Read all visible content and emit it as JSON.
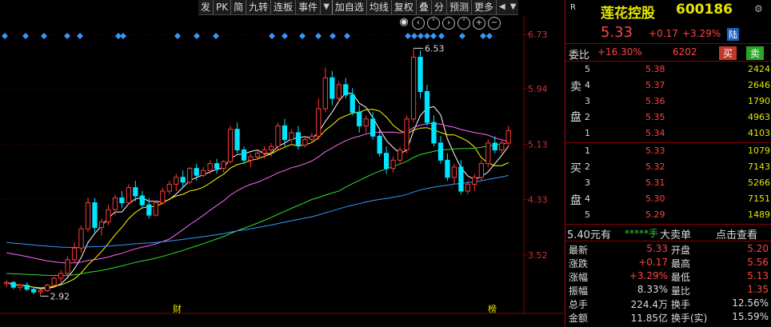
{
  "toolbar": {
    "items": [
      "发",
      "PK",
      "简",
      "九转",
      "连板",
      "事件",
      "加自选",
      "均线",
      "复权",
      "叠",
      "分",
      "预测",
      "更多"
    ]
  },
  "chart_data": {
    "type": "candlestick",
    "y_axis_labels": [
      "6.73",
      "5.94",
      "5.13",
      "4.33",
      "3.52"
    ],
    "ylim": [
      2.75,
      7.0
    ],
    "annotations": {
      "high_label": "6.53",
      "low_label": "2.92"
    },
    "bottom_markers": [
      "财",
      "榜"
    ],
    "candles": [
      [
        3.1,
        3.15,
        3.05,
        3.12
      ],
      [
        3.12,
        3.14,
        3.02,
        3.05
      ],
      [
        3.05,
        3.1,
        3.0,
        3.08
      ],
      [
        3.08,
        3.12,
        3.0,
        3.02
      ],
      [
        3.02,
        3.05,
        2.95,
        2.98
      ],
      [
        2.98,
        3.02,
        2.92,
        3.0
      ],
      [
        3.0,
        3.1,
        2.98,
        3.08
      ],
      [
        3.08,
        3.2,
        3.05,
        3.18
      ],
      [
        3.18,
        3.3,
        3.12,
        3.25
      ],
      [
        3.25,
        3.5,
        3.2,
        3.45
      ],
      [
        3.45,
        3.7,
        3.4,
        3.62
      ],
      [
        3.62,
        3.95,
        3.55,
        3.9
      ],
      [
        3.9,
        4.35,
        3.85,
        4.28
      ],
      [
        4.28,
        4.35,
        3.85,
        3.92
      ],
      [
        3.92,
        4.05,
        3.8,
        4.0
      ],
      [
        4.0,
        4.25,
        3.95,
        4.18
      ],
      [
        4.18,
        4.4,
        4.1,
        4.35
      ],
      [
        4.35,
        4.45,
        4.2,
        4.28
      ],
      [
        4.28,
        4.55,
        4.25,
        4.5
      ],
      [
        4.5,
        4.6,
        4.3,
        4.38
      ],
      [
        4.38,
        4.45,
        4.2,
        4.25
      ],
      [
        4.25,
        4.35,
        4.05,
        4.1
      ],
      [
        4.1,
        4.3,
        4.08,
        4.28
      ],
      [
        4.28,
        4.5,
        4.25,
        4.45
      ],
      [
        4.45,
        4.6,
        4.4,
        4.55
      ],
      [
        4.55,
        4.7,
        4.45,
        4.65
      ],
      [
        4.65,
        4.75,
        4.5,
        4.58
      ],
      [
        4.58,
        4.8,
        4.55,
        4.78
      ],
      [
        4.78,
        4.85,
        4.6,
        4.68
      ],
      [
        4.68,
        4.8,
        4.65,
        4.75
      ],
      [
        4.75,
        4.9,
        4.7,
        4.85
      ],
      [
        4.85,
        4.92,
        4.7,
        4.78
      ],
      [
        4.78,
        4.9,
        4.72,
        4.88
      ],
      [
        4.88,
        5.4,
        4.85,
        5.35
      ],
      [
        5.35,
        5.45,
        5.0,
        5.05
      ],
      [
        5.05,
        5.1,
        4.85,
        4.9
      ],
      [
        4.9,
        5.0,
        4.8,
        4.95
      ],
      [
        4.95,
        5.05,
        4.9,
        5.0
      ],
      [
        5.0,
        5.1,
        4.92,
        5.05
      ],
      [
        5.05,
        5.15,
        4.95,
        5.1
      ],
      [
        5.1,
        5.45,
        5.05,
        5.4
      ],
      [
        5.4,
        5.5,
        5.1,
        5.2
      ],
      [
        5.2,
        5.35,
        5.15,
        5.3
      ],
      [
        5.3,
        5.4,
        5.05,
        5.12
      ],
      [
        5.12,
        5.25,
        5.08,
        5.2
      ],
      [
        5.2,
        5.3,
        5.15,
        5.25
      ],
      [
        5.25,
        5.8,
        5.2,
        5.65
      ],
      [
        5.65,
        6.25,
        5.6,
        6.1
      ],
      [
        6.1,
        6.2,
        5.7,
        5.8
      ],
      [
        5.8,
        6.05,
        5.75,
        6.0
      ],
      [
        6.0,
        6.1,
        5.8,
        5.85
      ],
      [
        5.85,
        5.95,
        5.55,
        5.6
      ],
      [
        5.6,
        5.7,
        5.3,
        5.4
      ],
      [
        5.4,
        5.55,
        5.3,
        5.5
      ],
      [
        5.5,
        5.6,
        5.2,
        5.25
      ],
      [
        5.25,
        5.35,
        4.95,
        5.0
      ],
      [
        5.0,
        5.1,
        4.7,
        4.78
      ],
      [
        4.78,
        4.95,
        4.72,
        4.9
      ],
      [
        4.9,
        5.1,
        4.85,
        5.05
      ],
      [
        5.05,
        5.55,
        5.0,
        5.5
      ],
      [
        5.5,
        6.53,
        5.45,
        6.4
      ],
      [
        6.4,
        6.5,
        5.8,
        5.9
      ],
      [
        5.9,
        6.0,
        5.4,
        5.45
      ],
      [
        5.45,
        5.55,
        5.1,
        5.15
      ],
      [
        5.15,
        5.25,
        4.85,
        4.9
      ],
      [
        4.9,
        5.0,
        4.6,
        4.65
      ],
      [
        4.65,
        4.85,
        4.55,
        4.8
      ],
      [
        4.8,
        4.9,
        4.4,
        4.45
      ],
      [
        4.45,
        4.6,
        4.4,
        4.55
      ],
      [
        4.55,
        4.7,
        4.45,
        4.65
      ],
      [
        4.65,
        4.9,
        4.6,
        4.85
      ],
      [
        4.85,
        5.2,
        4.8,
        5.15
      ],
      [
        5.15,
        5.25,
        5.0,
        5.05
      ],
      [
        5.05,
        5.2,
        5.0,
        5.15
      ],
      [
        5.15,
        5.4,
        5.1,
        5.33
      ]
    ]
  },
  "stock": {
    "name": "莲花控股",
    "code": "600186",
    "r_label": "R",
    "price": "5.33",
    "change": "+0.17",
    "change_pct": "+3.29%",
    "market_tag": "陆"
  },
  "commission": {
    "label": "委比",
    "ratio": "+16.30%",
    "diff": "6202",
    "sell_btn": "买",
    "buy_btn": "卖"
  },
  "sell_side_label": [
    "卖",
    "盘"
  ],
  "buy_side_label": [
    "买",
    "盘"
  ],
  "asks": [
    {
      "level": "5",
      "price": "5.38",
      "vol": "2424"
    },
    {
      "level": "4",
      "price": "5.37",
      "vol": "2646"
    },
    {
      "level": "3",
      "price": "5.36",
      "vol": "1790"
    },
    {
      "level": "2",
      "price": "5.35",
      "vol": "4963"
    },
    {
      "level": "1",
      "price": "5.34",
      "vol": "4103"
    }
  ],
  "bids": [
    {
      "level": "1",
      "price": "5.33",
      "vol": "1079"
    },
    {
      "level": "2",
      "price": "5.32",
      "vol": "7143"
    },
    {
      "level": "3",
      "price": "5.31",
      "vol": "5266"
    },
    {
      "level": "4",
      "price": "5.30",
      "vol": "7151"
    },
    {
      "level": "5",
      "price": "5.29",
      "vol": "1489"
    }
  ],
  "big_order": {
    "price": "5.40元有",
    "stars": "*****手",
    "label": "大卖单",
    "link": "点击查看"
  },
  "stats": [
    {
      "l1": "最新",
      "v1": "5.33",
      "c1": "red",
      "l2": "开盘",
      "v2": "5.20",
      "c2": "red"
    },
    {
      "l1": "涨跌",
      "v1": "+0.17",
      "c1": "red",
      "l2": "最高",
      "v2": "5.56",
      "c2": "red"
    },
    {
      "l1": "涨幅",
      "v1": "+3.29%",
      "c1": "red",
      "l2": "最低",
      "v2": "5.13",
      "c2": "red"
    },
    {
      "l1": "振幅",
      "v1": "8.33%",
      "c1": "wh",
      "l2": "量比",
      "v2": "1.35",
      "c2": "red"
    },
    {
      "l1": "总手",
      "v1": "224.4万",
      "c1": "wh",
      "l2": "换手",
      "v2": "12.56%",
      "c2": "wh"
    },
    {
      "l1": "金额",
      "v1": "11.85亿",
      "c1": "wh",
      "l2": "换手(实)",
      "v2": "15.59%",
      "c2": "wh"
    }
  ],
  "colors": {
    "up": "#ff3b3b",
    "down": "#00e5ff",
    "ma5": "#ffffff",
    "ma10": "#ffff00",
    "ma20": "#ff66ff",
    "ma60": "#33dd33",
    "ma120": "#3399ff"
  }
}
